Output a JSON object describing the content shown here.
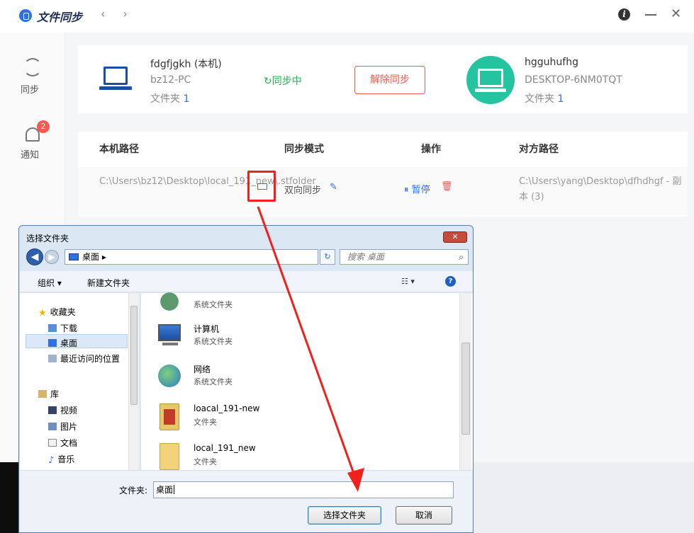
{
  "app": {
    "title": "文件同步",
    "nav_arrows": "‹ ›"
  },
  "window_controls": {
    "info": "i",
    "close": "✕"
  },
  "sidebar": {
    "items": [
      {
        "label": "同步",
        "icon": "sync-icon"
      },
      {
        "label": "通知",
        "icon": "bell-icon",
        "badge": "2"
      }
    ]
  },
  "local_device": {
    "name": "fdgfjgkh (本机)",
    "host": "bz12-PC",
    "folder_label": "文件夹",
    "folder_count": "1"
  },
  "sync_status": "↻同步中",
  "unsync_button": "解除同步",
  "remote_device": {
    "name": "hgguhufhg",
    "host": "DESKTOP-6NM0TQT",
    "folder_label": "文件夹",
    "folder_count": "1"
  },
  "table": {
    "headers": [
      "本机路径",
      "同步模式",
      "操作",
      "对方路径"
    ],
    "rows": [
      {
        "local_path": "C:\\Users\\bz12\\Desktop\\local_191_new\\.stfolder",
        "mode": "双向同步",
        "pause": "⏸ 暂停",
        "delete": "🗑",
        "remote_path": "C:\\Users\\yang\\Desktop\\dfhdhgf - 副本 (3)"
      }
    ]
  },
  "dialog": {
    "title": "选择文件夹",
    "close": "✕",
    "address": "桌面",
    "address_arrow": "▸",
    "search_placeholder": "搜索 桌面",
    "toolbar": {
      "organize": "组织 ▾",
      "new_folder": "新建文件夹",
      "view": "▾",
      "help": "?"
    },
    "nav": [
      {
        "label": "收藏夹",
        "icon": "star-icon"
      },
      {
        "label": "下载",
        "icon": "download-folder-icon"
      },
      {
        "label": "桌面",
        "icon": "desktop-icon",
        "selected": true
      },
      {
        "label": "最近访问的位置",
        "icon": "recent-icon"
      },
      {
        "label": "库",
        "icon": "library-icon"
      },
      {
        "label": "视频",
        "icon": "video-icon"
      },
      {
        "label": "图片",
        "icon": "picture-icon"
      },
      {
        "label": "文档",
        "icon": "document-icon"
      },
      {
        "label": "音乐",
        "icon": "music-icon"
      }
    ],
    "files": [
      {
        "name": "",
        "type": "系统文件夹",
        "icon": "user-folder-icon"
      },
      {
        "name": "计算机",
        "type": "系统文件夹",
        "icon": "computer-icon"
      },
      {
        "name": "网络",
        "type": "系统文件夹",
        "icon": "network-icon"
      },
      {
        "name": "loacal_191-new",
        "type": "文件夹",
        "icon": "folder-icon"
      },
      {
        "name": "local_191_new",
        "type": "文件夹",
        "icon": "folder-icon"
      }
    ],
    "folder_label": "文件夹:",
    "folder_value": "桌面",
    "ok_button": "选择文件夹",
    "cancel_button": "取消"
  },
  "colors": {
    "brand_blue": "#2f6fe4",
    "sync_green": "#20b44f",
    "danger_red": "#f25b4f",
    "remote_teal": "#25c4a0",
    "annotation_red": "#f0211a"
  }
}
